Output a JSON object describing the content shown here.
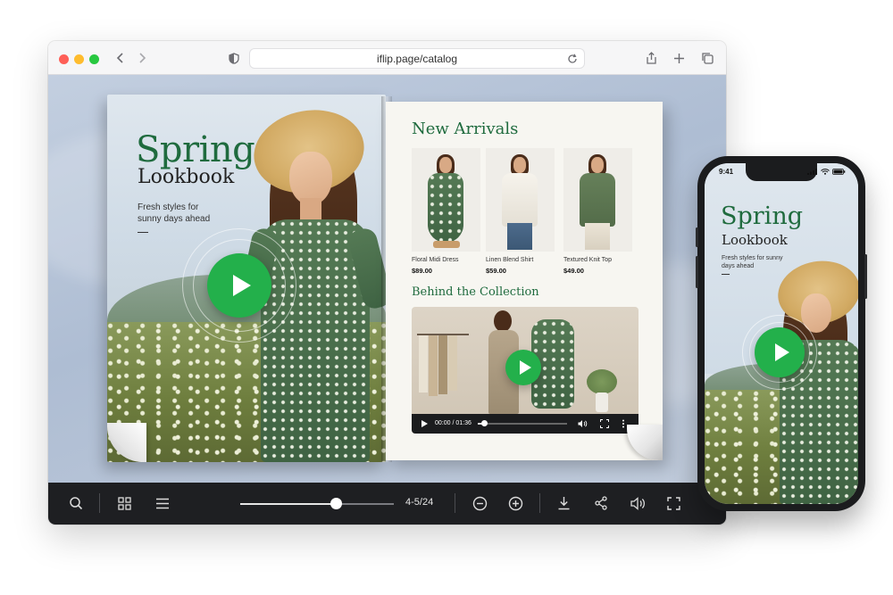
{
  "browser": {
    "url": "iflip.page/catalog"
  },
  "cover": {
    "title": "Spring",
    "subtitle": "Lookbook",
    "tagline": "Fresh styles for sunny days ahead"
  },
  "right_page": {
    "heading": "New Arrivals",
    "products": [
      {
        "name": "Floral Midi Dress",
        "price": "$89.00"
      },
      {
        "name": "Linen Blend Shirt",
        "price": "$59.00"
      },
      {
        "name": "Textured Knit Top",
        "price": "$49.00"
      }
    ],
    "section_heading": "Behind the Collection",
    "video": {
      "time": "00:00 / 01:36",
      "progress": 0.07
    }
  },
  "controls": {
    "page_indicator": "4-5/24",
    "slider_position": 0.62
  },
  "phone": {
    "time": "9:41",
    "title": "Spring",
    "subtitle": "Lookbook",
    "tagline": "Fresh styles for sunny days ahead"
  },
  "colors": {
    "brand_green": "#1f6b3e",
    "play_green": "#23b04b",
    "control_bar": "#1e1f22"
  },
  "icons": {
    "toolbar": [
      "back-icon",
      "forward-icon",
      "shield-icon",
      "reload-icon",
      "share-icon",
      "new-tab-icon",
      "tabs-icon"
    ],
    "controls": [
      "search-icon",
      "grid-icon",
      "menu-icon",
      "zoom-out-icon",
      "zoom-in-icon",
      "download-icon",
      "share-icon",
      "volume-icon",
      "fullscreen-icon"
    ]
  }
}
